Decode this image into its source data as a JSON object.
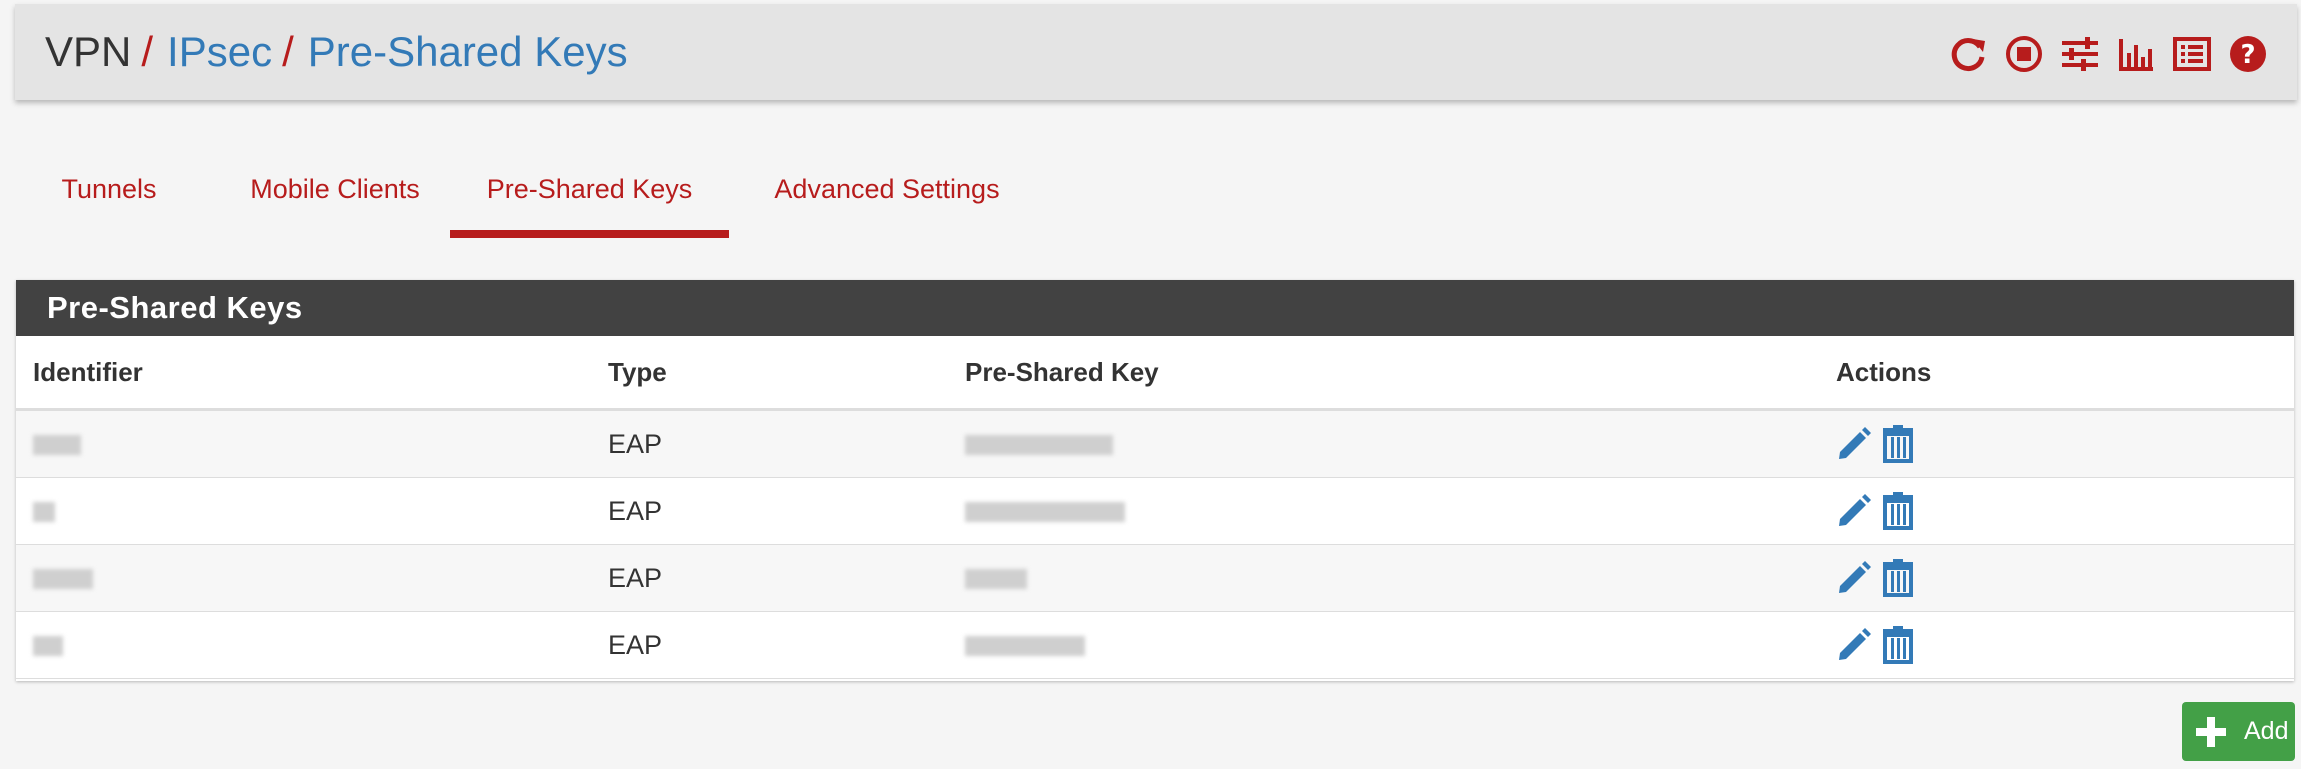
{
  "breadcrumb": {
    "root": "VPN",
    "separator": "/",
    "level1": "IPsec",
    "level2": "Pre-Shared Keys"
  },
  "header_icons": [
    "reload-icon",
    "stop-icon",
    "settings-sliders-icon",
    "chart-icon",
    "log-list-icon",
    "help-icon"
  ],
  "tabs": [
    {
      "label": "Tunnels",
      "active": false
    },
    {
      "label": "Mobile Clients",
      "active": false
    },
    {
      "label": "Pre-Shared Keys",
      "active": true
    },
    {
      "label": "Advanced Settings",
      "active": false
    }
  ],
  "panel": {
    "title": "Pre-Shared Keys",
    "columns": [
      "Identifier",
      "Type",
      "Pre-Shared Key",
      "Actions"
    ],
    "rows": [
      {
        "identifier": "",
        "type": "EAP",
        "key": ""
      },
      {
        "identifier": "",
        "type": "EAP",
        "key": ""
      },
      {
        "identifier": "",
        "type": "EAP",
        "key": ""
      },
      {
        "identifier": "",
        "type": "EAP",
        "key": ""
      }
    ]
  },
  "add_button": {
    "label": "Add"
  },
  "colors": {
    "accent_red": "#b71c1c",
    "link_blue": "#337ab7",
    "panel_header": "#424242",
    "add_green": "#43a047"
  }
}
